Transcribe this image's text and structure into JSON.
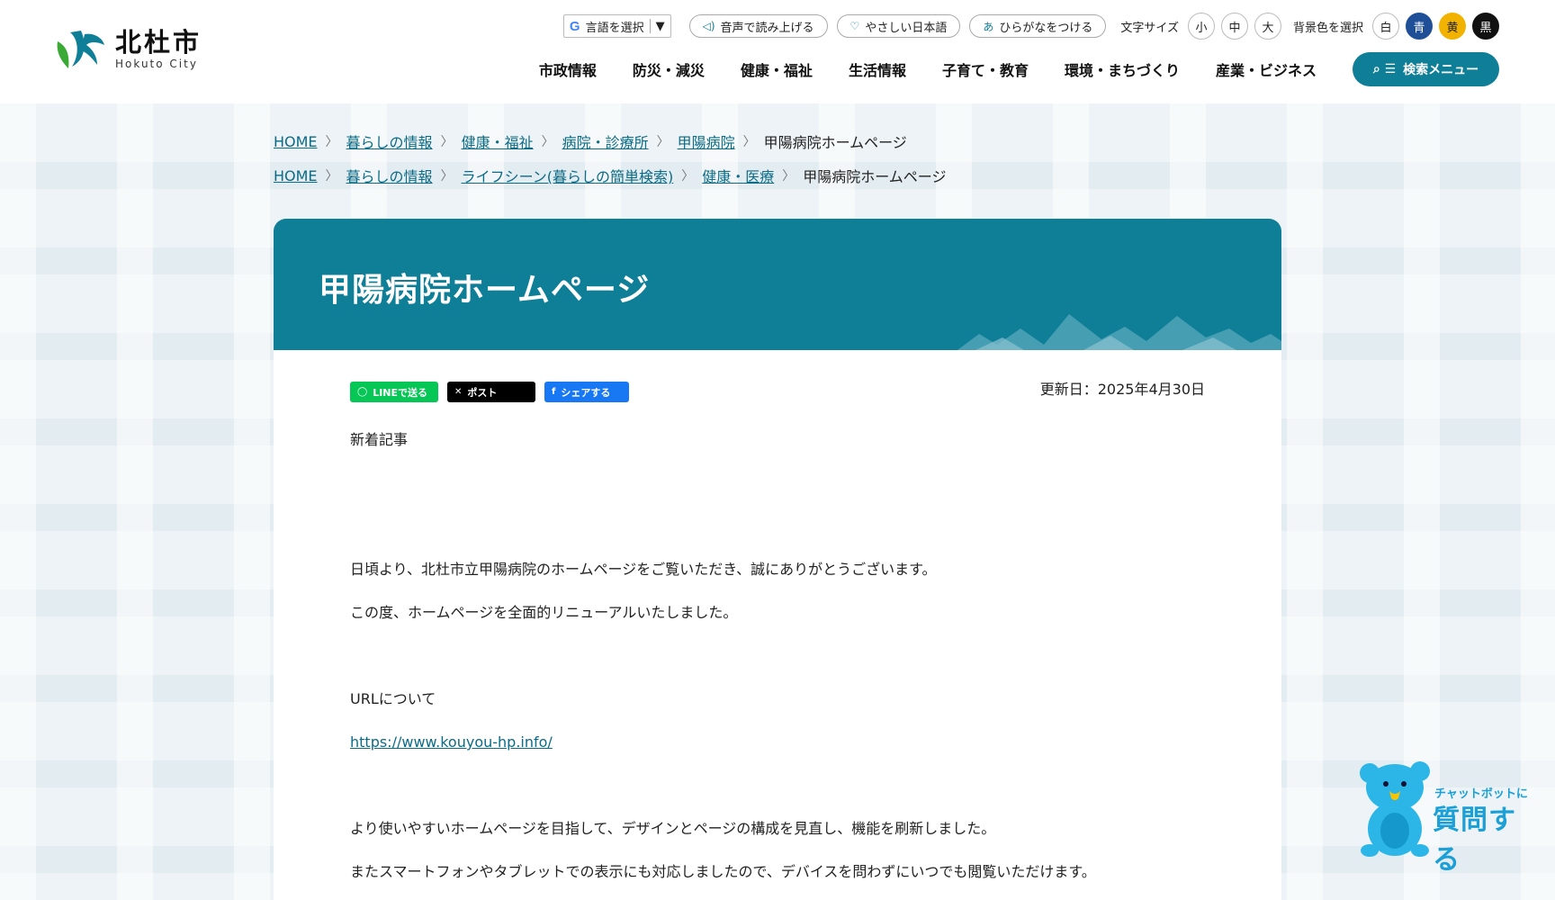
{
  "site": {
    "logo_jp": "北杜市",
    "logo_en": "Hokuto City"
  },
  "utility": {
    "language_label": "言語を選択",
    "language_arrow": "▼",
    "read_aloud": "音声で読み上げる",
    "easy_japanese": "やさしい日本語",
    "furigana": "ひらがなをつける",
    "font_size_label": "文字サイズ",
    "font_sizes": [
      "小",
      "中",
      "大"
    ],
    "bg_color_label": "背景色を選択",
    "bg_colors": [
      "白",
      "青",
      "黄",
      "黒"
    ]
  },
  "nav": {
    "items": [
      "市政情報",
      "防災・減災",
      "健康・福祉",
      "生活情報",
      "子育て・教育",
      "環境・まちづくり",
      "産業・ビジネス"
    ],
    "search_menu": "検索メニュー"
  },
  "breadcrumbs": [
    {
      "links": [
        "HOME",
        "暮らしの情報",
        "健康・福祉",
        "病院・診療所",
        "甲陽病院"
      ],
      "current": "甲陽病院ホームページ"
    },
    {
      "links": [
        "HOME",
        "暮らしの情報",
        "ライフシーン(暮らしの簡単検索)",
        "健康・医療"
      ],
      "current": "甲陽病院ホームページ"
    }
  ],
  "page": {
    "title": "甲陽病院ホームページ",
    "updated": "更新日：2025年4月30日",
    "share": {
      "line": "LINEで送る",
      "x": "ポスト",
      "facebook": "シェアする"
    }
  },
  "content": {
    "heading_new": "新着記事",
    "para1": "日頃より、北杜市立甲陽病院のホームページをご覧いただき、誠にありがとうございます。",
    "para2": "この度、ホームページを全面的リニューアルいたしました。",
    "url_heading": "URLについて",
    "url": "https://www.kouyou-hp.info/",
    "para3": "より使いやすいホームページを目指して、デザインとページの構成を見直し、機能を刷新しました。",
    "para4": "またスマートフォンやタブレットでの表示にも対応しましたので、デバイスを問わずにいつでも閲覧いただけます。"
  },
  "chatbot": {
    "small": "チャットボットに",
    "big": "質問する"
  },
  "colors": {
    "brand": "#0f7e97",
    "link": "#0c6b86"
  }
}
